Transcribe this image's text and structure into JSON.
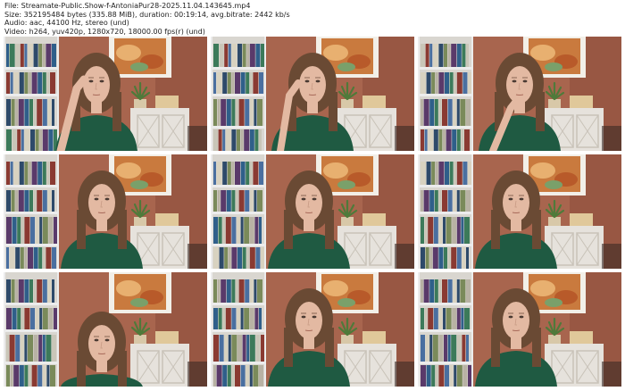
{
  "header": {
    "file": "File: Streamate-Public.Show-f-AntoniaPur28-2025.11.04.143645.mp4",
    "size": "Size: 352195484 bytes (335.88 MiB), duration: 00:19:14, avg.bitrate: 2442 kb/s",
    "audio": "Audio: aac, 44100 Hz, stereo (und)",
    "video": "Video: h264, yuv420p, 1280x720, 18000.00 fps(r) (und)"
  },
  "colors": {
    "wall": "#a8654e",
    "wall_dark": "#7a3f32",
    "shelf": "#ececec",
    "cabinet": "#e6e2dc",
    "sweater": "#1f5a42",
    "hair": "#6a4a34",
    "skin": "#e3b9a2",
    "painting": "#c97a3e"
  },
  "thumbnails": [
    {
      "pose": "hand-to-head-left"
    },
    {
      "pose": "hand-to-face-right"
    },
    {
      "pose": "hand-to-chin"
    },
    {
      "pose": "neutral"
    },
    {
      "pose": "neutral"
    },
    {
      "pose": "neutral"
    },
    {
      "pose": "low-frame"
    },
    {
      "pose": "neutral"
    },
    {
      "pose": "neutral"
    }
  ]
}
